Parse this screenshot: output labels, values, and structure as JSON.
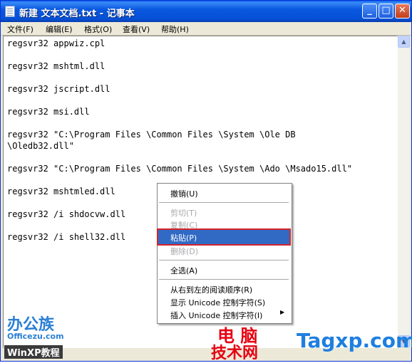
{
  "window": {
    "title": "新建 文本文档.txt - 记事本",
    "controls": {
      "minimize": "_",
      "maximize": "□",
      "close": "✕"
    }
  },
  "menu": {
    "items": [
      "文件(F)",
      "编辑(E)",
      "格式(O)",
      "查看(V)",
      "帮助(H)"
    ]
  },
  "editor": {
    "lines": [
      "regsvr32 appwiz.cpl",
      "regsvr32 mshtml.dll",
      "regsvr32 jscript.dll",
      "regsvr32 msi.dll",
      "regsvr32 \"C:\\Program Files \\Common Files \\System \\Ole DB",
      "\\Oledb32.dll\"",
      "regsvr32 \"C:\\Program Files \\Common Files \\System \\Ado \\Msado15.dll\"",
      "regsvr32 mshtmled.dll",
      "regsvr32 /i shdocvw.dll",
      "regsvr32 /i shell32.dll"
    ]
  },
  "context_menu": {
    "undo": "撤销(U)",
    "cut": "剪切(T)",
    "copy": "复制(C)",
    "paste": "粘贴(P)",
    "delete": "删除(D)",
    "select_all": "全选(A)",
    "rtl": "从右到左的阅读顺序(R)",
    "show_unicode": "显示 Unicode 控制字符(S)",
    "insert_unicode": "插入 Unicode 控制字符(I)"
  },
  "watermarks": {
    "logo1": "办公族",
    "logo1_sub": "Officezu.com",
    "logo2": "WinXP教程",
    "logo3": "电 脑",
    "logo3_sub": "技术网",
    "logo4": "Tagxp.com"
  },
  "colors": {
    "title_bar": "#0a58e0",
    "selection": "#316ac5",
    "highlight_box": "#d4242a"
  }
}
